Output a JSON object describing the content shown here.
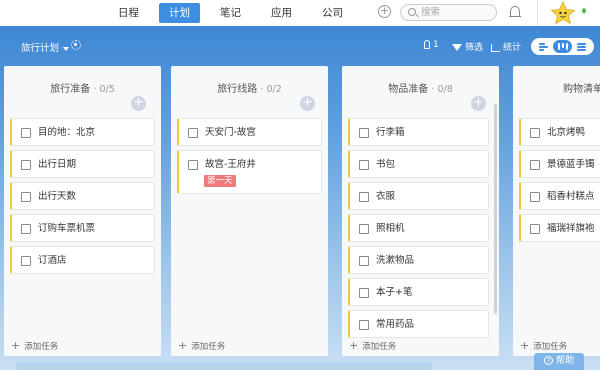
{
  "nav": {
    "tabs": [
      {
        "label": "日程",
        "active": false
      },
      {
        "label": "计划",
        "active": true
      },
      {
        "label": "笔记",
        "active": false
      },
      {
        "label": "应用",
        "active": false
      },
      {
        "label": "公司",
        "active": false
      }
    ],
    "search_placeholder": "搜索",
    "icons": [
      "plus-circle-icon",
      "search-icon",
      "bell-icon",
      "avatar-star",
      "gem-icon"
    ]
  },
  "toolbar": {
    "project_title": "旅行计划",
    "member_count": "1",
    "filter_label": "筛选",
    "stats_label": "统计"
  },
  "columns": [
    {
      "title": "旅行准备",
      "count": "· 0/5",
      "cards": [
        {
          "text": "目的地：北京"
        },
        {
          "text": "出行日期"
        },
        {
          "text": "出行天数"
        },
        {
          "text": "订购车票机票"
        },
        {
          "text": "订酒店"
        }
      ],
      "add_task": "添加任务"
    },
    {
      "title": "旅行线路",
      "count": "· 0/2",
      "cards": [
        {
          "text": "天安门-故宫"
        },
        {
          "text": "故宫-王府井",
          "tag": "第一天"
        }
      ],
      "add_task": "添加任务"
    },
    {
      "title": "物品准备",
      "count": "· 0/8",
      "cards": [
        {
          "text": "行李箱"
        },
        {
          "text": "书包"
        },
        {
          "text": "衣服"
        },
        {
          "text": "照相机"
        },
        {
          "text": "洗漱物品"
        },
        {
          "text": "本子+笔"
        },
        {
          "text": "常用药品"
        }
      ],
      "add_task": "添加任务"
    },
    {
      "title": "购物清单",
      "count": "",
      "cards": [
        {
          "text": "北京烤鸭"
        },
        {
          "text": "景德蓝手镯"
        },
        {
          "text": "稻香村糕点"
        },
        {
          "text": "福瑞祥旗袍"
        }
      ],
      "add_task": "添加任务"
    }
  ],
  "help_label": "帮助",
  "colors": {
    "accent": "#3d8ee0",
    "card_stripe": "#f0c93d",
    "tag": "#f07a7a"
  }
}
